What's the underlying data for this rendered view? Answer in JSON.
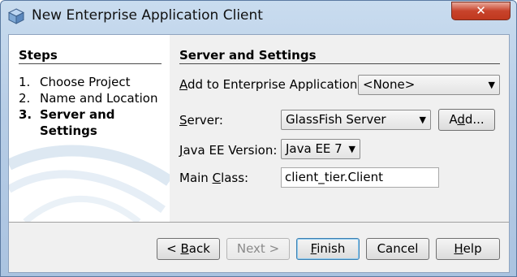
{
  "window": {
    "title": "New Enterprise Application Client",
    "close_glyph": "✕",
    "icon": "cube-icon"
  },
  "steps": {
    "title": "Steps",
    "items": [
      {
        "num": "1.",
        "label": "Choose Project"
      },
      {
        "num": "2.",
        "label": "Name and Location"
      },
      {
        "num": "3.",
        "label": "Server and",
        "label2": "Settings",
        "current": true
      }
    ]
  },
  "panel": {
    "title": "Server and Settings",
    "ear": {
      "label_mn": "A",
      "label_rest": "dd to Enterprise Application:",
      "value": "<None>"
    },
    "server": {
      "label_mn": "S",
      "label_rest": "erver:",
      "value": "GlassFish Server",
      "add_pre": "A",
      "add_mn": "d",
      "add_post": "d..."
    },
    "javaee": {
      "label_mn": "J",
      "label_rest": "ava EE Version:",
      "value": "Java EE 7"
    },
    "mainclass": {
      "label_pre": "Main ",
      "label_mn": "C",
      "label_rest": "lass:",
      "value": "client_tier.Client"
    }
  },
  "buttons": {
    "back_pre": "< ",
    "back_mn": "B",
    "back_rest": "ack",
    "next": "Next >",
    "finish_mn": "F",
    "finish_rest": "inish",
    "cancel": "Cancel",
    "help_mn": "H",
    "help_rest": "elp"
  },
  "colors": {
    "accent": "#3c7fb1",
    "close": "#c8432b"
  }
}
